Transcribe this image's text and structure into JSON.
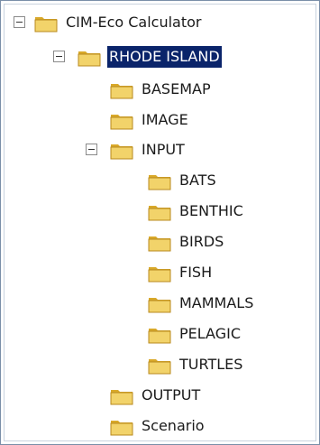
{
  "tree": {
    "root": {
      "label": "CIM-Eco Calculator",
      "expander": "minus",
      "icon": "folder-icon"
    },
    "state": {
      "label": "RHODE ISLAND",
      "expander": "minus",
      "icon": "folder-icon",
      "selected": true
    },
    "folders": {
      "basemap": "BASEMAP",
      "image": "IMAGE",
      "input": "INPUT",
      "output": "OUTPUT",
      "scenario": "Scenario"
    },
    "input_children": [
      "BATS",
      "BENTHIC",
      "BIRDS",
      "FISH",
      "MAMMALS",
      "PELAGIC",
      "TURTLES"
    ]
  },
  "colors": {
    "folder_fill": "#f2d36a",
    "folder_shade": "#d9a92a",
    "selection": "#0a246a",
    "border": "#7a8fa8"
  }
}
